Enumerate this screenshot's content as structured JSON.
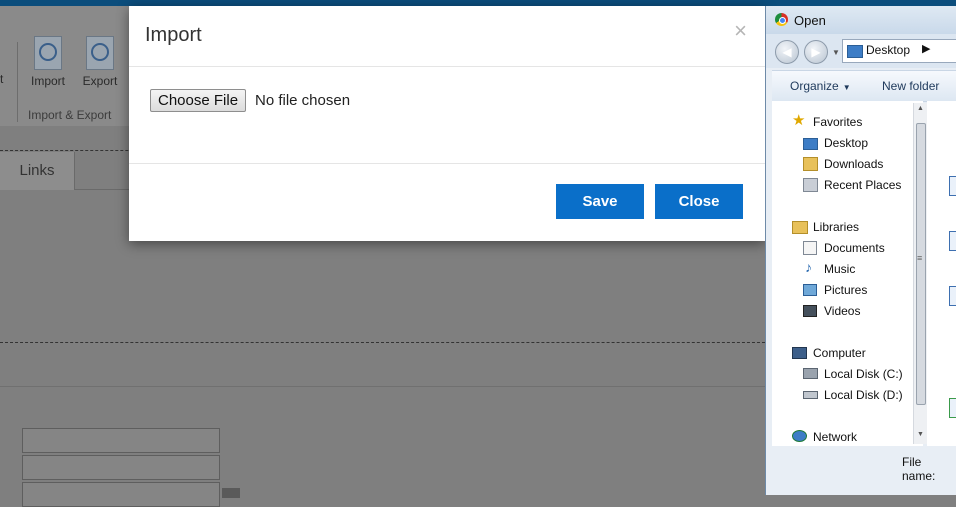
{
  "background": {
    "ribbon": {
      "left_fragment": "t",
      "import_label": "Import",
      "export_label": "Export",
      "group_label": "Import & Export"
    },
    "tab_label": "Links"
  },
  "import_modal": {
    "title": "Import",
    "close_x": "×",
    "choose_file_label": "Choose File",
    "no_file_text": "No file chosen",
    "save_label": "Save",
    "close_label": "Close",
    "accent_color": "#0a6fc9"
  },
  "open_dialog": {
    "title": "Open",
    "address": "Desktop",
    "toolbar": {
      "organize": "Organize",
      "new_folder": "New folder"
    },
    "tree": {
      "favorites": "Favorites",
      "desktop": "Desktop",
      "downloads": "Downloads",
      "recent_places": "Recent Places",
      "libraries": "Libraries",
      "documents": "Documents",
      "music": "Music",
      "pictures": "Pictures",
      "videos": "Videos",
      "computer": "Computer",
      "local_disk_c": "Local Disk (C:)",
      "local_disk_d": "Local Disk (D:)",
      "network": "Network"
    },
    "file_name_label": "File name:"
  }
}
